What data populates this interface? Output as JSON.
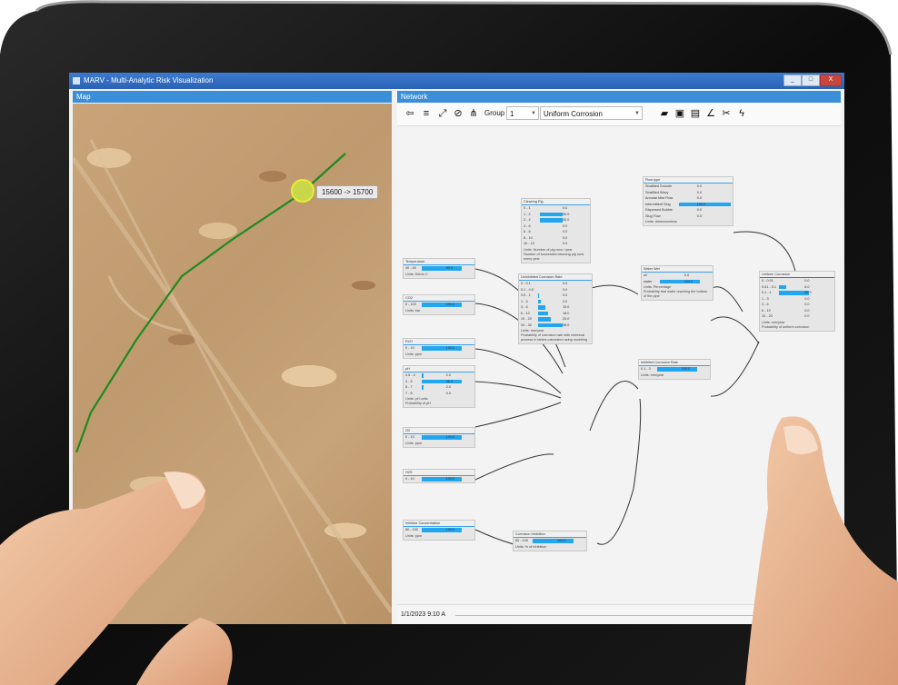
{
  "window": {
    "title": "MARV - Multi-Analytic Risk Visualization",
    "buttons": [
      "_",
      "□",
      "X"
    ]
  },
  "map_panel": {
    "title": "Map",
    "tooltip": "15600 -> 15700"
  },
  "network_panel": {
    "title": "Network",
    "group_label": "Group",
    "group_value": "1",
    "target_value": "Uniform Corrosion",
    "timestamp": "1/1/2023 9:10 A"
  },
  "colors": {
    "accent": "#3a8fd8",
    "bar": "#22a6f0",
    "pipeline": "#1f8a1f",
    "marker": "#c8d84a"
  },
  "icons": [
    "back-icon",
    "menu-icon",
    "expand-icon",
    "compass-icon",
    "hierarchy-icon",
    "folder-icon",
    "save-icon",
    "save-as-icon",
    "pick-icon",
    "tools-icon",
    "lightning-icon"
  ]
}
